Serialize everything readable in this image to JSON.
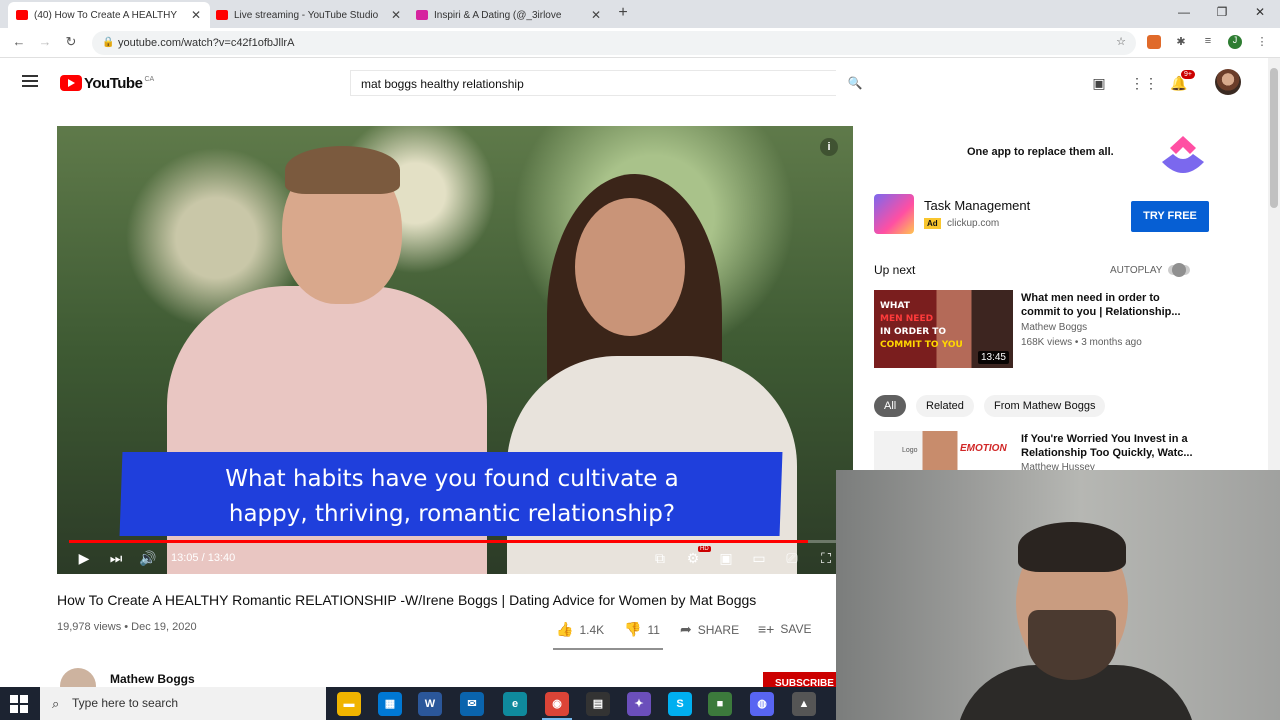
{
  "browser": {
    "tabs": [
      {
        "title": "(40) How To Create A HEALTHY",
        "active": true,
        "favicon_color": "#ff0000"
      },
      {
        "title": "Live streaming - YouTube Studio",
        "active": false,
        "favicon_color": "#ff0000"
      },
      {
        "title": "Inspiri & A Dating (@_3irlove",
        "active": false,
        "favicon_color": "#d6249f"
      }
    ],
    "url": "youtube.com/watch?v=c42f1ofbJllrA"
  },
  "youtube": {
    "logo_text": "YouTube",
    "country_code": "CA",
    "search_query": "mat boggs healthy relationship",
    "notification_count": "9+"
  },
  "player": {
    "caption_line1": "What habits have you found cultivate a",
    "caption_line2": "happy, thriving, romantic relationship?",
    "time": "13:05 / 13:40",
    "progress": 0.957,
    "hd_badge": "HD"
  },
  "video": {
    "title": "How To Create A HEALTHY Romantic RELATIONSHIP -W/Irene Boggs | Dating Advice for Women by Mat Boggs",
    "meta": "19,978 views • Dec 19, 2020",
    "likes": "1.4K",
    "dislikes": "11",
    "share_label": "SHARE",
    "save_label": "SAVE",
    "channel_name": "Mathew Boggs",
    "subscribe_label": "SUBSCRIBE"
  },
  "ad": {
    "tagline": "One app to replace them all.",
    "title": "Task Management",
    "badge": "Ad",
    "url": "clickup.com",
    "cta": "TRY FREE"
  },
  "sidebar": {
    "up_next_label": "Up next",
    "autoplay_label": "AUTOPLAY",
    "up_next": {
      "title": "What men need in order to commit to you | Relationship...",
      "channel": "Mathew Boggs",
      "meta": "168K views • 3 months ago",
      "duration": "13:45",
      "thumb_line1": "WHAT",
      "thumb_line2": "MEN NEED",
      "thumb_line3": "IN ORDER TO",
      "thumb_line4": "COMMIT TO YOU"
    },
    "chips": [
      "All",
      "Related",
      "From Mathew Boggs"
    ],
    "rec2": {
      "title": "If You're Worried You Invest in a Relationship Too Quickly, Watc...",
      "channel": "Matthew Hussey",
      "thumb_word": "EMOTION",
      "thumb_logo": "Logo"
    }
  },
  "taskbar": {
    "search_placeholder": "Type here to search"
  }
}
